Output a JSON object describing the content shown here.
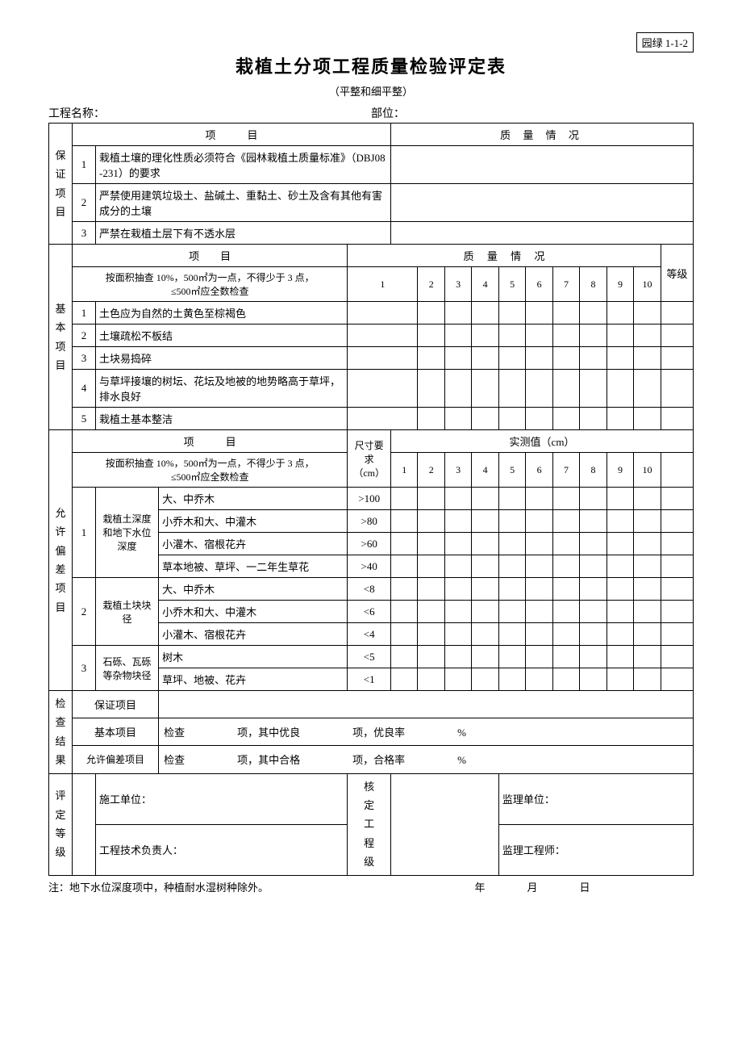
{
  "doc_code": "园绿 1-1-2",
  "title": "栽植土分项工程质量检验评定表",
  "subtitle": "（平整和细平整）",
  "header": {
    "project_label": "工程名称：",
    "part_label": "部位："
  },
  "col_project": "项　　　目",
  "col_quality": "质 量 情 况",
  "grade_label": "等级",
  "guarantee": {
    "label": "保证项目",
    "items": [
      "栽植土壤的理化性质必须符合《园林栽植土质量标准》（DBJ08-231）的要求",
      "严禁使用建筑垃圾土、盐碱土、重黏土、砂土及含有其他有害成分的土壤",
      "严禁在栽植土层下有不透水层"
    ]
  },
  "basic": {
    "label": "基本项目",
    "header_project": "项　　目",
    "header_quality": "质　 量　 情　 况",
    "sampling": "按面积抽查 10%，500㎡为一点，不得少于 3 点，\n≤500㎡应全数检查",
    "nums": [
      "1",
      "2",
      "3",
      "4",
      "5",
      "6",
      "7",
      "8",
      "9",
      "10"
    ],
    "items": [
      "土色应为自然的土黄色至棕褐色",
      "土壤疏松不板结",
      "土块易捣碎",
      "与草坪接壤的树坛、花坛及地被的地势略高于草坪，排水良好",
      "栽植土基本整洁"
    ]
  },
  "deviation": {
    "label": "允许偏差项目",
    "header_project": "项　　　目",
    "size_req": "尺寸要求",
    "size_unit": "（cm）",
    "measured": "实测值（cm）",
    "sampling": "按面积抽查 10%，500㎡为一点，不得少于 3 点，\n≤500㎡应全数检查",
    "nums": [
      "1",
      "2",
      "3",
      "4",
      "5",
      "6",
      "7",
      "8",
      "9",
      "10"
    ],
    "groups": [
      {
        "no": "1",
        "name": "栽植土深度和地下水位深度",
        "rows": [
          {
            "item": "大、中乔木",
            "req": ">100"
          },
          {
            "item": "小乔木和大、中灌木",
            "req": ">80"
          },
          {
            "item": "小灌木、宿根花卉",
            "req": ">60"
          },
          {
            "item": "草本地被、草坪、一二年生草花",
            "req": ">40"
          }
        ]
      },
      {
        "no": "2",
        "name": "栽植土块块径",
        "rows": [
          {
            "item": "大、中乔木",
            "req": "<8"
          },
          {
            "item": "小乔木和大、中灌木",
            "req": "<6"
          },
          {
            "item": "小灌木、宿根花卉",
            "req": "<4"
          }
        ]
      },
      {
        "no": "3",
        "name": "石砾、瓦砾等杂物块径",
        "rows": [
          {
            "item": "树木",
            "req": "<5"
          },
          {
            "item": "草坪、地被、花卉",
            "req": "<1"
          }
        ]
      }
    ]
  },
  "results": {
    "label": "检查结果",
    "guarantee_row": "保证项目",
    "basic_row_label": "基本项目",
    "basic_row_text": "检查　　　　　项，其中优良　　　　　项，优良率　　　　　%",
    "dev_row_label": "允许偏差项目",
    "dev_row_text": "检查　　　　　项，其中合格　　　　　项，合格率　　　　　%"
  },
  "signoff": {
    "left_label": "评定等级",
    "construction_unit": "施工单位：",
    "tech_leader": "工程技术负责人：",
    "mid_label": "核定工程级",
    "supervise_unit": "监理单位：",
    "supervise_eng": "监理工程师："
  },
  "footnote": "注：地下水位深度项中，种植耐水湿树种除外。",
  "date": "年　　　　月　　　　日"
}
